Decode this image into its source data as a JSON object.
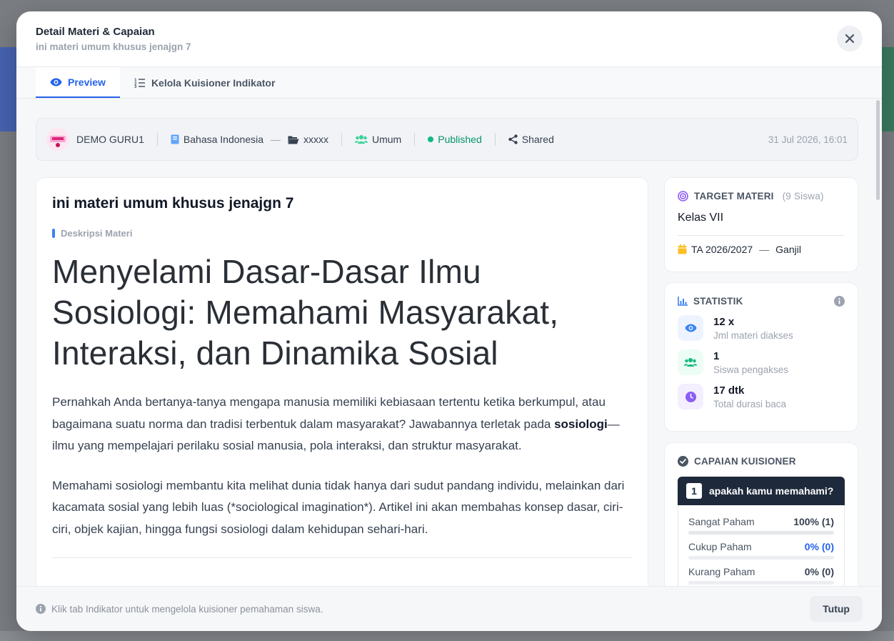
{
  "modal": {
    "title": "Detail Materi & Capaian",
    "subtitle": "ini materi umum khusus jenajgn 7"
  },
  "tabs": [
    {
      "label": "Preview",
      "icon": "eye-icon",
      "active": true
    },
    {
      "label": "Kelola Kuisioner Indikator",
      "icon": "list-ordered-icon",
      "active": false
    }
  ],
  "meta": {
    "author": "DEMO GURU1",
    "subject": "Bahasa Indonesia",
    "folder": "xxxxx",
    "audience": "Umum",
    "status": "Published",
    "sharing": "Shared",
    "datetime": "31 Jul 2026, 16:01"
  },
  "content": {
    "title": "ini materi umum khusus jenajgn 7",
    "section_label": "Deskripsi Materi",
    "heading": "Menyelami Dasar-Dasar Ilmu Sosiologi: Memahami Masyarakat, Interaksi, dan Dinamika Sosial",
    "para1_a": "Pernahkah Anda bertanya-tanya mengapa manusia memiliki kebiasaan tertentu ketika berkumpul, atau bagaimana suatu norma dan tradisi terbentuk dalam masyarakat? Jawabannya terletak pada ",
    "para1_bold": "sosiologi",
    "para1_b": "—ilmu yang mempelajari perilaku sosial manusia, pola interaksi, dan struktur masyarakat.",
    "para2": "Memahami sosiologi membantu kita melihat dunia tidak hanya dari sudut pandang individu, melainkan dari kacamata sosial yang lebih luas (*sociological imagination*). Artikel ini akan membahas konsep dasar, ciri-ciri, objek kajian, hingga fungsi sosiologi dalam kehidupan sehari-hari."
  },
  "target": {
    "heading": "TARGET MATERI",
    "count": "(9 Siswa)",
    "kelas": "Kelas VII",
    "tahun": "TA 2026/2027",
    "dash": "—",
    "semester": "Ganjil"
  },
  "statistik": {
    "heading": "STATISTIK",
    "items": [
      {
        "value": "12 x",
        "label": "Jml materi diakses",
        "icon": "eye-icon",
        "color": "#3b82f6",
        "bg": "#eef4ff"
      },
      {
        "value": "1",
        "label": "Siswa pengakses",
        "icon": "users-icon",
        "color": "#10b981",
        "bg": "#ecfdf5"
      },
      {
        "value": "17 dtk",
        "label": "Total durasi baca",
        "icon": "clock-icon",
        "color": "#8b5cf6",
        "bg": "#f3efff"
      }
    ]
  },
  "capaian": {
    "heading": "CAPAIAN KUISIONER",
    "question_number": "1",
    "question": "apakah kamu memahami?",
    "options": [
      {
        "label": "Sangat Paham",
        "pct": "100% (1)",
        "fill": 100,
        "highlight": false
      },
      {
        "label": "Cukup Paham",
        "pct": "0% (0)",
        "fill": 0,
        "highlight": true
      },
      {
        "label": "Kurang Paham",
        "pct": "0% (0)",
        "fill": 0,
        "highlight": false
      }
    ]
  },
  "footer": {
    "note": "Klik tab Indikator untuk mengelola kuisioner pemahaman siswa.",
    "close_label": "Tutup"
  }
}
